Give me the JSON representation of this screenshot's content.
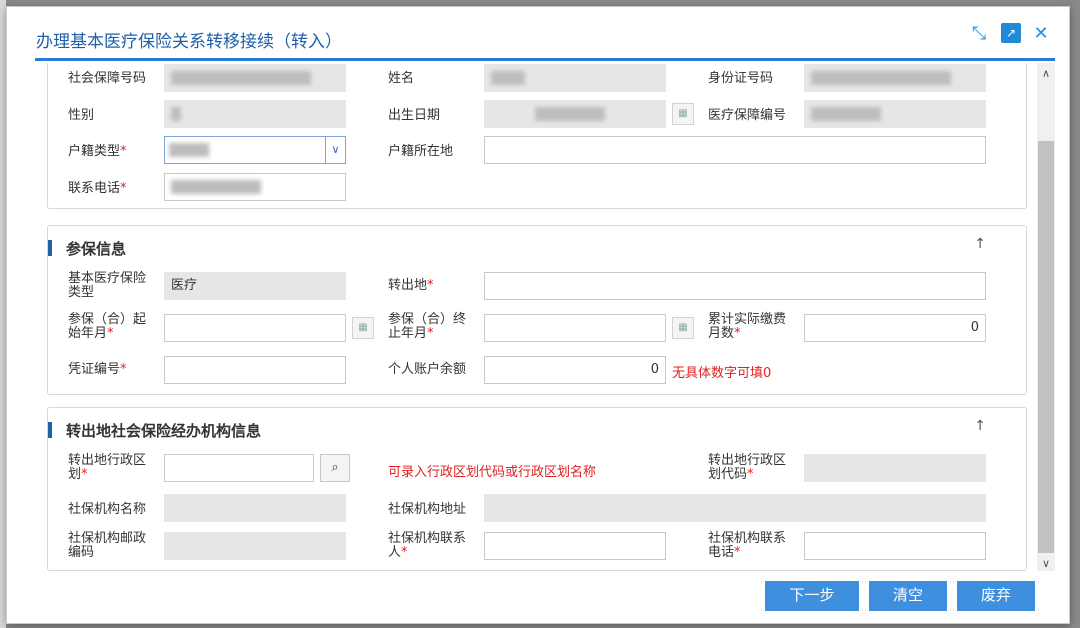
{
  "dialog": {
    "title": "办理基本医疗保险关系转移接续（转入）",
    "icons": {
      "resize": "resize-icon",
      "open": "open-external-icon",
      "close": "close-icon"
    }
  },
  "personal": {
    "ssn_label": "社会保障号码",
    "name_label": "姓名",
    "id_label": "身份证号码",
    "gender_label": "性别",
    "birth_label": "出生日期",
    "medical_no_label": "医疗保障编号",
    "hukou_type_label": "户籍类型",
    "hukou_place_label": "户籍所在地",
    "phone_label": "联系电话",
    "required_mark": "*"
  },
  "insurance": {
    "title": "参保信息",
    "basic_label": "基本医疗保险类型",
    "basic_value": "医疗",
    "transfer_out_label": "转出地",
    "start_label": "参保（合）起始年月",
    "end_label": "参保（合）终止年月",
    "months_label": "累计实际缴费月数",
    "months_value": "0",
    "voucher_label": "凭证编号",
    "balance_label": "个人账户余额",
    "balance_value": "0",
    "balance_hint": "无具体数字可填0"
  },
  "agency": {
    "title": "转出地社会保险经办机构信息",
    "region_label": "转出地行政区划",
    "region_hint": "可录入行政区划代码或行政区划名称",
    "region_code_label": "转出地行政区划代码",
    "name_label": "社保机构名称",
    "address_label": "社保机构地址",
    "postcode_label": "社保机构邮政编码",
    "contact_label": "社保机构联系人",
    "contact_phone_label": "社保机构联系电话"
  },
  "buttons": {
    "next": "下一步",
    "clear": "清空",
    "discard": "废弃"
  },
  "colors": {
    "accent": "#2a7bd6",
    "button": "#3e8fde",
    "required": "#e02020"
  }
}
